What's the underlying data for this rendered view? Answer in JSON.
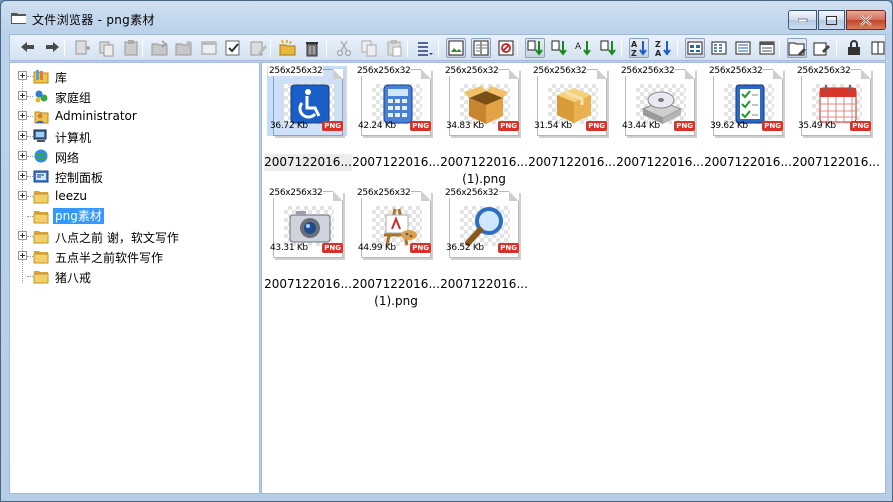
{
  "window": {
    "title": "文件浏览器 - png素材",
    "controls": [
      "minimize",
      "maximize",
      "close"
    ]
  },
  "toolbar": {
    "buttons": [
      {
        "name": "back-icon"
      },
      {
        "name": "forward-icon"
      },
      {
        "name": "new-file-icon"
      },
      {
        "name": "copy-file-icon"
      },
      {
        "name": "paste-file-icon"
      },
      {
        "name": "open-folder-icon"
      },
      {
        "name": "folder-options-icon"
      },
      {
        "name": "window-icon"
      },
      {
        "name": "check-icon"
      },
      {
        "name": "edit-icon"
      },
      {
        "name": "new-folder-icon"
      },
      {
        "name": "delete-icon"
      },
      {
        "name": "cut-icon"
      },
      {
        "name": "copy-icon"
      },
      {
        "name": "paste-icon"
      },
      {
        "name": "list-menu-icon"
      },
      {
        "name": "thumbnail-view-icon",
        "selected": true
      },
      {
        "name": "preview-pane-icon",
        "selected": true
      },
      {
        "name": "stop-icon"
      },
      {
        "name": "sort-size-icon",
        "selected": true
      },
      {
        "name": "sort-type-icon"
      },
      {
        "name": "sort-date-icon"
      },
      {
        "name": "sort-modified-icon"
      },
      {
        "name": "sort-az-icon",
        "selected": true
      },
      {
        "name": "sort-za-icon"
      },
      {
        "name": "large-icons-view-icon",
        "selected": true
      },
      {
        "name": "small-icons-view-icon"
      },
      {
        "name": "list-view-icon"
      },
      {
        "name": "details-view-icon"
      },
      {
        "name": "folder-tools-icon",
        "selected": true
      },
      {
        "name": "properties-icon"
      },
      {
        "name": "lock-icon"
      },
      {
        "name": "more-icon"
      }
    ]
  },
  "tree": {
    "items": [
      {
        "label": "库",
        "icon": "library-icon",
        "expandable": true
      },
      {
        "label": "家庭组",
        "icon": "homegroup-icon",
        "expandable": true
      },
      {
        "label": "Administrator",
        "icon": "user-folder-icon",
        "expandable": true
      },
      {
        "label": "计算机",
        "icon": "computer-icon",
        "expandable": true
      },
      {
        "label": "网络",
        "icon": "network-icon",
        "expandable": true
      },
      {
        "label": "控制面板",
        "icon": "control-panel-icon",
        "expandable": true
      },
      {
        "label": "leezu",
        "icon": "folder-icon",
        "expandable": true
      },
      {
        "label": "png素材",
        "icon": "folder-icon",
        "expandable": false,
        "selected": true
      },
      {
        "label": "八点之前  谢，软文写作",
        "icon": "folder-icon",
        "expandable": true
      },
      {
        "label": "五点半之前软件写作",
        "icon": "folder-icon",
        "expandable": true
      },
      {
        "label": "猪八戒",
        "icon": "folder-icon",
        "expandable": false
      }
    ]
  },
  "files": [
    {
      "dims": "256x256x32",
      "size": "36.72 Kb",
      "badge": "PNG",
      "name": "2007122016...",
      "name2": "",
      "art": "accessibility-icon",
      "selected": true
    },
    {
      "dims": "256x256x32",
      "size": "42.24 Kb",
      "badge": "PNG",
      "name": "2007122016...",
      "name2": "",
      "art": "calculator-icon"
    },
    {
      "dims": "256x256x32",
      "size": "34.83 Kb",
      "badge": "PNG",
      "name": "2007122016...",
      "name2": "(1).png",
      "art": "open-box-icon"
    },
    {
      "dims": "256x256x32",
      "size": "31.54 Kb",
      "badge": "PNG",
      "name": "2007122016...",
      "name2": "",
      "art": "closed-box-icon"
    },
    {
      "dims": "256x256x32",
      "size": "43.44 Kb",
      "badge": "PNG",
      "name": "2007122016...",
      "name2": "",
      "art": "cd-drive-icon"
    },
    {
      "dims": "256x256x32",
      "size": "39.62 Kb",
      "badge": "PNG",
      "name": "2007122016...",
      "name2": "",
      "art": "checklist-icon"
    },
    {
      "dims": "256x256x32",
      "size": "35.49 Kb",
      "badge": "PNG",
      "name": "2007122016...",
      "name2": "",
      "art": "calendar-icon"
    },
    {
      "dims": "256x256x32",
      "size": "43.31 Kb",
      "badge": "PNG",
      "name": "2007122016...",
      "name2": "",
      "art": "camera-icon"
    },
    {
      "dims": "256x256x32",
      "size": "44.99 Kb",
      "badge": "PNG",
      "name": "2007122016...",
      "name2": "(1).png",
      "art": "easel-icon"
    },
    {
      "dims": "256x256x32",
      "size": "36.52 Kb",
      "badge": "PNG",
      "name": "2007122016...",
      "name2": "",
      "art": "magnifier-icon"
    }
  ],
  "colors": {
    "accent": "#3399ff",
    "frame": "#b7cde6",
    "badge": "#d9302a"
  }
}
